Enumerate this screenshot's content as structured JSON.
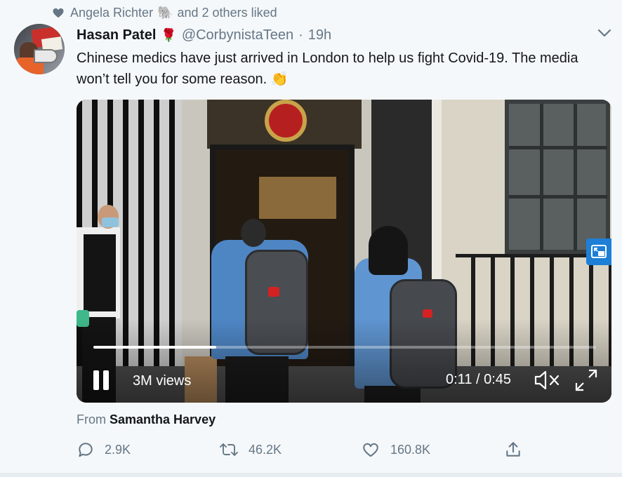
{
  "social_context": {
    "icon": "heart-icon",
    "liked_by": "Angela Richter",
    "emoji": "🐘",
    "suffix": "and 2 others liked"
  },
  "tweet": {
    "display_name": "Hasan Patel",
    "name_emoji": "🌹",
    "handle": "@CorbynistaTeen",
    "separator": "·",
    "time": "19h",
    "text": "Chinese medics have just arrived in London to help us fight Covid-19. The media won’t tell you for some reason. 👏"
  },
  "video": {
    "views": "3M views",
    "timecode": "0:11 / 0:45",
    "progress_fraction": 0.245,
    "pip_icon": "picture-in-picture-icon",
    "pip_color": "#1d7fd6"
  },
  "attribution": {
    "prefix": "From",
    "source": "Samantha Harvey"
  },
  "actions": {
    "reply_count": "2.9K",
    "retweet_count": "46.2K",
    "like_count": "160.8K"
  },
  "colors": {
    "background": "#f5f8fa",
    "primary_text": "#14171a",
    "secondary_text": "#657786",
    "accent": "#1d7fd6"
  }
}
